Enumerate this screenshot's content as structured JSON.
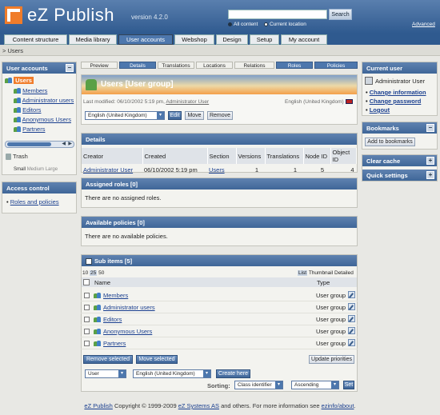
{
  "header": {
    "brand": "eZ Publish",
    "version": "version 4.2.0",
    "search_button": "Search",
    "radio_all": "All content",
    "radio_current": "Current location",
    "advanced": "Advanced"
  },
  "tabs": [
    "Content structure",
    "Media library",
    "User accounts",
    "Webshop",
    "Design",
    "Setup",
    "My account"
  ],
  "breadcrumb": "> Users",
  "left": {
    "user_accounts_title": "User accounts",
    "tree": [
      "Users",
      "Members",
      "Administrator users",
      "Editors",
      "Anonymous Users",
      "Partners"
    ],
    "trash": "Trash",
    "sizes": [
      "Small",
      "Medium",
      "Large"
    ],
    "access_control_title": "Access control",
    "roles_link": "Roles and policies"
  },
  "view_tabs": [
    "Preview",
    "Details",
    "Translations",
    "Locations",
    "Relations",
    "Roles",
    "Policies"
  ],
  "object": {
    "title": "Users [User group]",
    "last_modified_label": "Last modified: 06/10/2002 5:19 pm,",
    "modifier": "Administrator User",
    "language": "English (United Kingdom)",
    "language_select": "English (United Kingdom)",
    "edit": "Edit",
    "move": "Move",
    "remove": "Remove"
  },
  "details": {
    "title": "Details",
    "headers": [
      "Creator",
      "Created",
      "Section",
      "Versions",
      "Translations",
      "Node ID",
      "Object ID"
    ],
    "row": [
      "Administrator User",
      "06/10/2002 5:19 pm",
      "Users",
      "1",
      "1",
      "5",
      "4"
    ]
  },
  "assigned_roles": {
    "title": "Assigned roles [0]",
    "message": "There are no assigned roles."
  },
  "available_policies": {
    "title": "Available policies [0]",
    "message": "There are no available policies."
  },
  "subitems": {
    "title": "Sub items [5]",
    "limits": [
      "10",
      "25",
      "50"
    ],
    "views": [
      "List",
      "Thumbnail",
      "Detailed"
    ],
    "col_name": "Name",
    "col_type": "Type",
    "rows": [
      {
        "name": "Members",
        "type": "User group"
      },
      {
        "name": "Administrator users",
        "type": "User group"
      },
      {
        "name": "Editors",
        "type": "User group"
      },
      {
        "name": "Anonymous Users",
        "type": "User group"
      },
      {
        "name": "Partners",
        "type": "User group"
      }
    ],
    "remove_selected": "Remove selected",
    "move_selected": "Move selected",
    "update_priorities": "Update priorities",
    "class_select": "User",
    "lang_select": "English (United Kingdom)",
    "create_here": "Create here",
    "sorting_label": "Sorting:",
    "sort_field": "Class identifier",
    "sort_order": "Ascending",
    "set": "Set"
  },
  "right": {
    "current_user_title": "Current user",
    "user_name": "Administrator User",
    "links": [
      "Change information",
      "Change password",
      "Logout"
    ],
    "bookmarks_title": "Bookmarks",
    "add_bookmarks": "Add to bookmarks",
    "clear_cache_title": "Clear cache",
    "quick_settings_title": "Quick settings"
  },
  "footer": {
    "brand_link": "eZ Publish",
    "copyright": "Copyright © 1999-2009",
    "company_link": "eZ Systems AS",
    "tail": "and others. For more information see",
    "about_link": "ezinfo/about",
    "end": "."
  },
  "colors": {
    "header_blue": "#2f5a8f",
    "accent_orange": "#f07c2a",
    "panel_head": "#4d77ad"
  }
}
